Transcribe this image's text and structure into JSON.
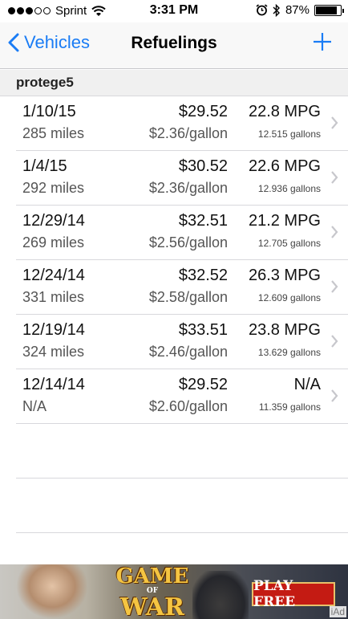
{
  "status_bar": {
    "carrier": "Sprint",
    "time": "3:31 PM",
    "battery": "87%",
    "battery_level": 0.87
  },
  "nav": {
    "back_label": "Vehicles",
    "title": "Refuelings",
    "add_icon": "plus-icon",
    "accent_color": "#1a7cf5"
  },
  "section": {
    "title": "protege5"
  },
  "refuelings": [
    {
      "date": "1/10/15",
      "miles": "285 miles",
      "price": "$29.52",
      "price_per_gallon": "$2.36/gallon",
      "mpg": "22.8 MPG",
      "gallons": "12.515 gallons"
    },
    {
      "date": "1/4/15",
      "miles": "292 miles",
      "price": "$30.52",
      "price_per_gallon": "$2.36/gallon",
      "mpg": "22.6 MPG",
      "gallons": "12.936 gallons"
    },
    {
      "date": "12/29/14",
      "miles": "269 miles",
      "price": "$32.51",
      "price_per_gallon": "$2.56/gallon",
      "mpg": "21.2 MPG",
      "gallons": "12.705 gallons"
    },
    {
      "date": "12/24/14",
      "miles": "331 miles",
      "price": "$32.52",
      "price_per_gallon": "$2.58/gallon",
      "mpg": "26.3 MPG",
      "gallons": "12.609 gallons"
    },
    {
      "date": "12/19/14",
      "miles": "324 miles",
      "price": "$33.51",
      "price_per_gallon": "$2.46/gallon",
      "mpg": "23.8 MPG",
      "gallons": "13.629 gallons"
    },
    {
      "date": "12/14/14",
      "miles": "N/A",
      "price": "$29.52",
      "price_per_gallon": "$2.60/gallon",
      "mpg": "N/A",
      "gallons": "11.359 gallons"
    }
  ],
  "ad": {
    "logo_line1": "GAME",
    "logo_line2": "OF",
    "logo_line3": "WAR",
    "button_label": "PLAY FREE",
    "badge": "iAd"
  }
}
